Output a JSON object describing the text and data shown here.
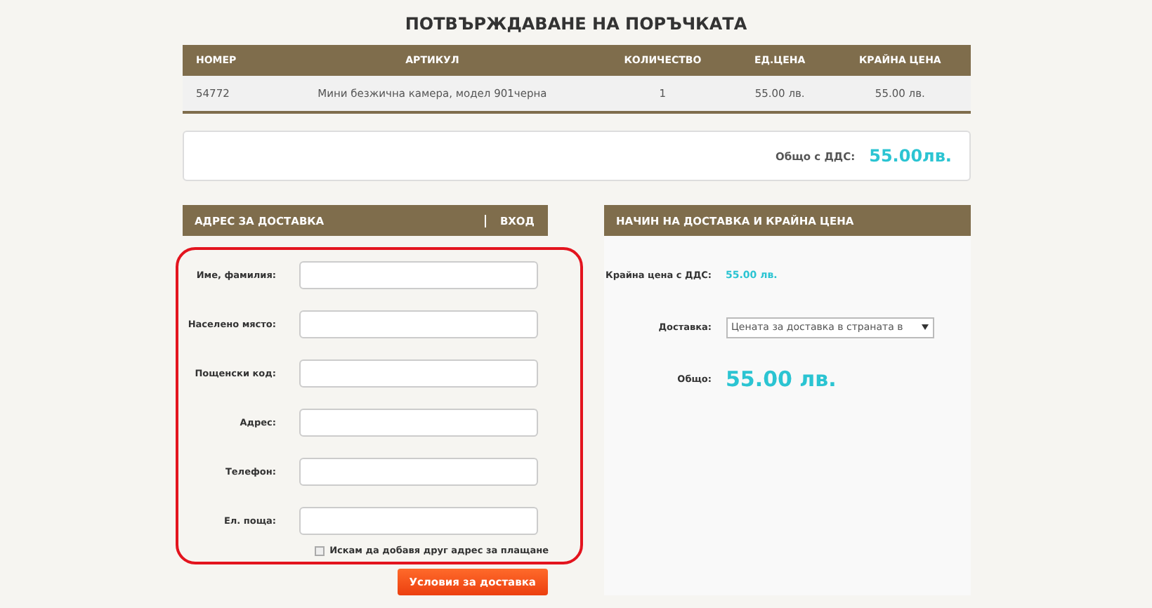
{
  "title": "ПОТВЪРЖДАВАНЕ НА ПОРЪЧКАТА",
  "table": {
    "columns": [
      "НОМЕР",
      "АРТИКУЛ",
      "КОЛИЧЕСТВО",
      "ЕД.ЦЕНА",
      "КРАЙНА ЦЕНА"
    ],
    "rows": [
      [
        "54772",
        "Мини безжична камера, модел 901черна",
        "1",
        "55.00 лв.",
        "55.00 лв."
      ]
    ]
  },
  "total": {
    "label": "Общо с ДДС:",
    "value": "55.00лв."
  },
  "address": {
    "title": "АДРЕС ЗА ДОСТАВКА",
    "login": "ВХОД",
    "fields": [
      {
        "label": "Име, фамилия:"
      },
      {
        "label": "Населено място:"
      },
      {
        "label": "Пощенски код:"
      },
      {
        "label": "Адрес:"
      },
      {
        "label": "Телефон:"
      },
      {
        "label": "Ел. поща:"
      }
    ],
    "checkbox": {
      "label": "Искам да добавя друг адрес за плащане",
      "checked": false
    },
    "button": "Условия за доставка"
  },
  "shipping": {
    "title": "НАЧИН НА ДОСТАВКА И КРАЙНА ЦЕНА",
    "price_label": "Крайна цена с ДДС:",
    "price": "55.00 лв.",
    "delivery_label": "Доставка:",
    "delivery_value": "Цената за доставка в страната в",
    "total_label": "Общо:",
    "total": "55.00 лв."
  }
}
